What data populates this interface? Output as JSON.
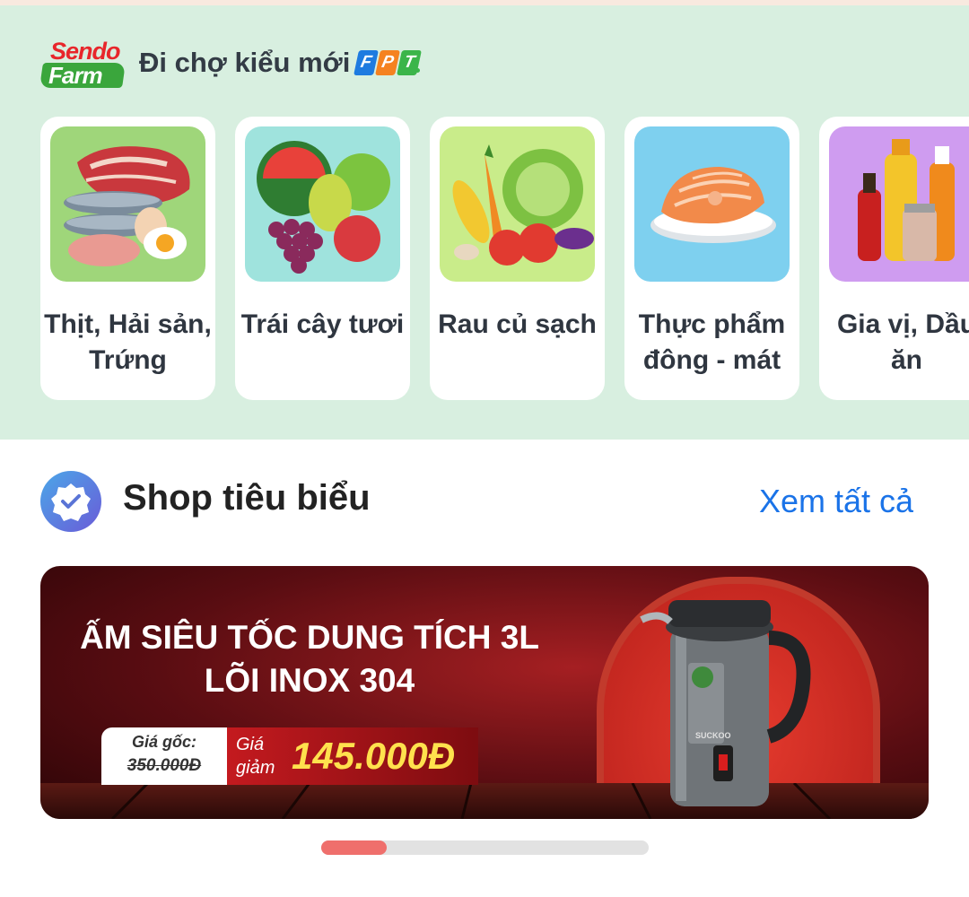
{
  "sendo_farm": {
    "logo_top": "Sendo",
    "logo_bottom": "Farm",
    "tagline": "Đi chợ kiểu mới",
    "partner_logo_letters": [
      "F",
      "P",
      "T"
    ],
    "background_color": "#d8efe0",
    "categories": [
      {
        "label": "Thịt, Hải sản, Trứng",
        "icon": "meat-seafood-eggs-image",
        "tile_color": "#9fd67a"
      },
      {
        "label": "Trái cây tươi",
        "icon": "fresh-fruit-image",
        "tile_color": "#9fe3dd"
      },
      {
        "label": "Rau củ sạch",
        "icon": "vegetables-image",
        "tile_color": "#c9ec8a"
      },
      {
        "label": "Thực phẩm đông - mát",
        "icon": "frozen-salmon-image",
        "tile_color": "#7ed0ef"
      },
      {
        "label": "Gia vị, Dầu ăn",
        "icon": "spices-oil-image",
        "tile_color": "#cf9cf0"
      }
    ]
  },
  "featured_shops": {
    "title": "Shop tiêu biểu",
    "icon": "verified-badge-icon",
    "see_all": "Xem tất cả",
    "accent_color": "#1a73e8"
  },
  "banner": {
    "headline_line1": "ẤM SIÊU TỐC DUNG TÍCH 3L",
    "headline_line2": "LÕI INOX 304",
    "original_price_label": "Giá gốc:",
    "original_price": "350.000Đ",
    "sale_price_label": "Giá giảm",
    "sale_price": "145.000Đ",
    "product_image": "electric-kettle-image",
    "product_brand_text": "SUCKOO"
  },
  "carousel": {
    "active_index": 0,
    "total_pages": 5,
    "active_color": "#ef6f6c"
  }
}
